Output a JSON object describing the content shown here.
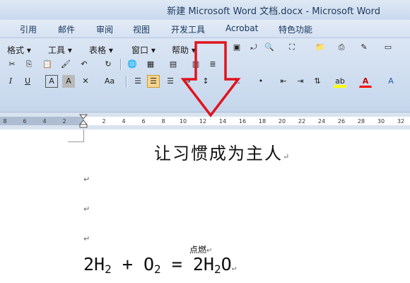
{
  "window": {
    "title": "新建 Microsoft Word 文档.docx - Microsoft Word"
  },
  "menubar": {
    "items": [
      "引用",
      "邮件",
      "审阅",
      "视图",
      "开发工具",
      "Acrobat",
      "特色功能"
    ]
  },
  "toolbar_row1": {
    "menus": [
      "格式",
      "工具",
      "表格",
      "窗口",
      "帮助"
    ]
  },
  "toolbar_row2": {
    "buttons": {
      "italic": "I",
      "underline": "U",
      "char_border": "A",
      "char_shading": "A",
      "font_scale": "Aa"
    }
  },
  "ruler": {
    "ticks": [
      "8",
      "6",
      "4",
      "2",
      "2",
      "4",
      "6",
      "8",
      "10",
      "12",
      "14",
      "16",
      "18",
      "20",
      "22",
      "24",
      "26",
      "28",
      "30",
      "32"
    ]
  },
  "document": {
    "heading": "让习惯成为主人",
    "para_mark": "↵",
    "condition": "点燃",
    "formula": {
      "coef1": "2H",
      "sub1": "2",
      "plus": "+",
      "o": "O",
      "sub2": "2",
      "eq": "=",
      "coef2": "2H",
      "sub3": "2",
      "o2": "O"
    }
  },
  "annotation": {
    "arrow_color": "#e0141e"
  },
  "colors": {
    "highlight": "#ffff00",
    "font_color": "#ff0000",
    "selected_button": "#f7d48a"
  }
}
